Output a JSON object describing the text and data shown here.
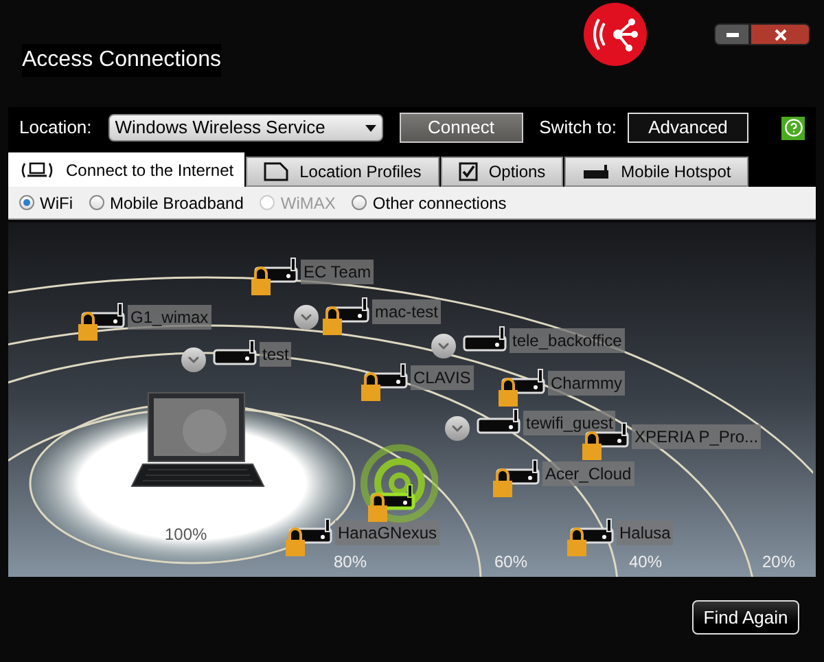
{
  "window": {
    "title": "Access Connections"
  },
  "toolbar": {
    "location_label": "Location:",
    "location_value": "Windows Wireless Service",
    "connect_button": "Connect",
    "switch_label": "Switch to:",
    "switch_button": "Advanced"
  },
  "tabs": [
    {
      "label": "Connect to the Internet",
      "selected": true,
      "kind": "internet"
    },
    {
      "label": "Location Profiles",
      "selected": false,
      "kind": "profiles"
    },
    {
      "label": "Options",
      "selected": false,
      "kind": "options"
    },
    {
      "label": "Mobile Hotspot",
      "selected": false,
      "kind": "hotspot"
    }
  ],
  "connection_types": [
    {
      "label": "WiFi",
      "selected": true,
      "disabled": false
    },
    {
      "label": "Mobile Broadband",
      "selected": false,
      "disabled": false
    },
    {
      "label": "WiMAX",
      "selected": false,
      "disabled": true
    },
    {
      "label": "Other connections",
      "selected": false,
      "disabled": false
    }
  ],
  "networks": [
    {
      "name": "EC Team",
      "locked": true,
      "grouped": false,
      "connected": false
    },
    {
      "name": "G1_wimax",
      "locked": true,
      "grouped": false,
      "connected": false
    },
    {
      "name": "mac-test",
      "locked": true,
      "grouped": true,
      "connected": false
    },
    {
      "name": "test",
      "locked": false,
      "grouped": true,
      "connected": false
    },
    {
      "name": "CLAVIS",
      "locked": true,
      "grouped": false,
      "connected": false
    },
    {
      "name": "tele_backoffice",
      "locked": false,
      "grouped": true,
      "connected": false
    },
    {
      "name": "Charmmy",
      "locked": true,
      "grouped": false,
      "connected": false
    },
    {
      "name": "tewifi_guest",
      "locked": false,
      "grouped": true,
      "connected": false
    },
    {
      "name": "XPERIA P_Pro...",
      "locked": true,
      "grouped": false,
      "connected": false
    },
    {
      "name": "Acer_Cloud",
      "locked": true,
      "grouped": false,
      "connected": false
    },
    {
      "name": "HanaGNexus",
      "locked": true,
      "grouped": false,
      "connected": false
    },
    {
      "name": "Halusa",
      "locked": true,
      "grouped": false,
      "connected": false
    },
    {
      "locked": true,
      "grouped": false,
      "connected": true
    }
  ],
  "signal_rings": [
    "100%",
    "80%",
    "60%",
    "40%",
    "20%"
  ],
  "find_again_button": "Find Again"
}
